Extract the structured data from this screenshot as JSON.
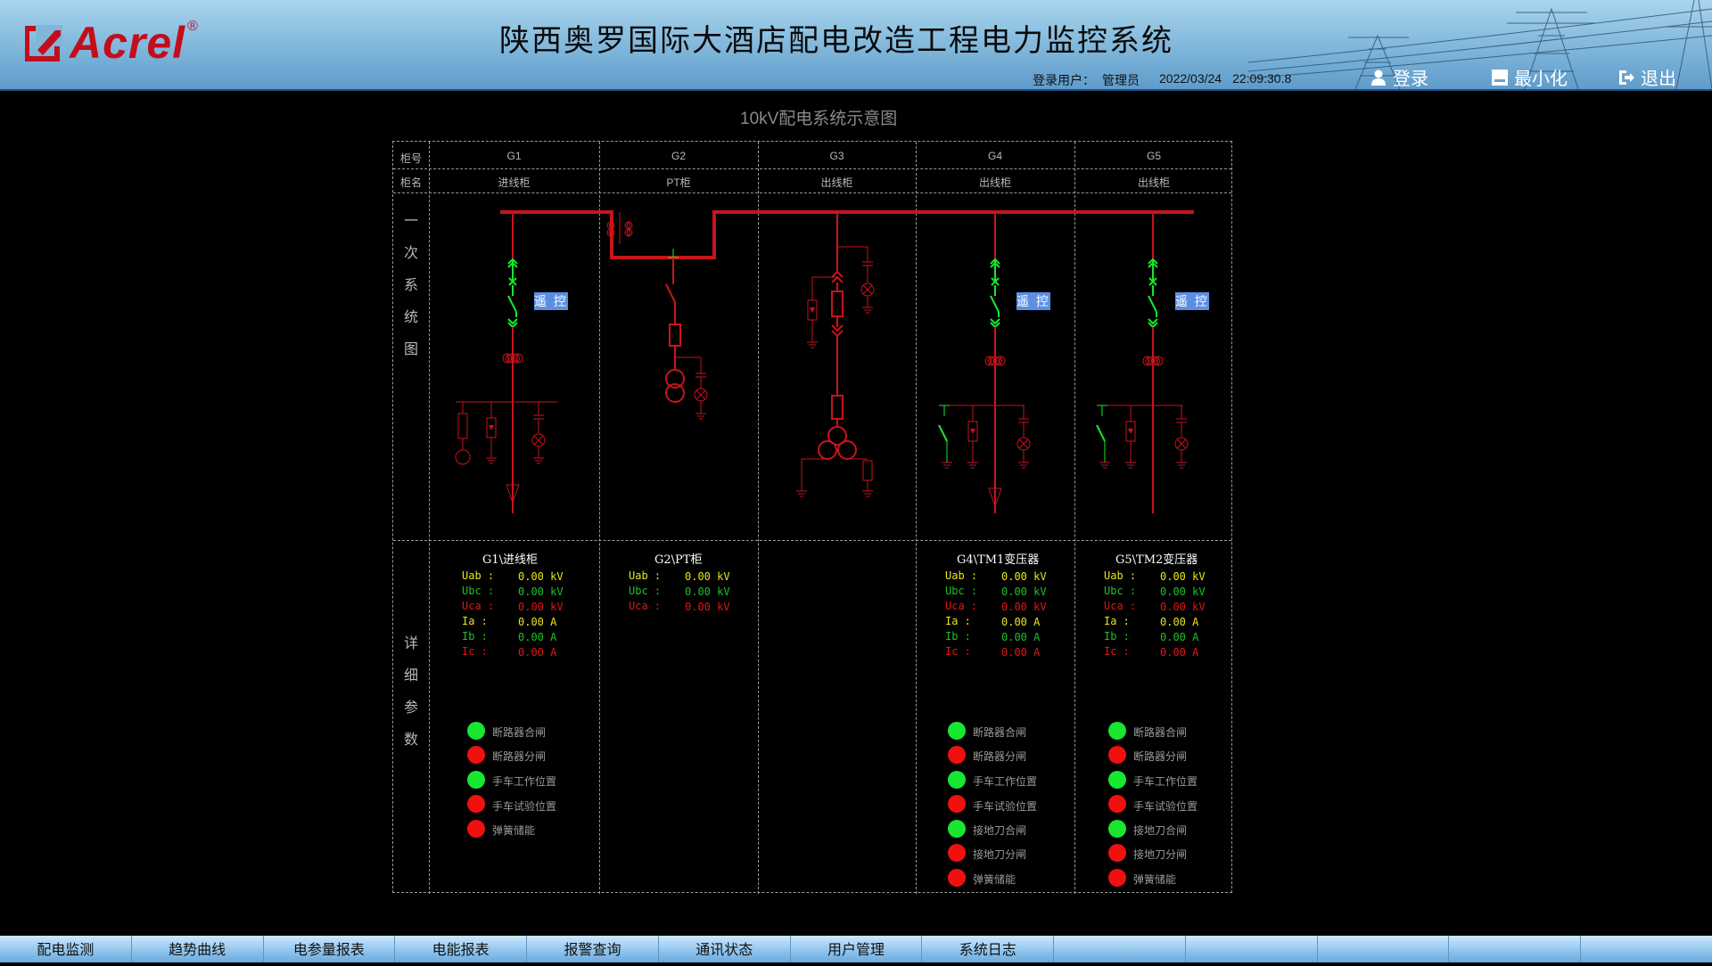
{
  "header": {
    "brand": "Acrel",
    "brand_mark": "®",
    "title": "陕西奥罗国际大酒店配电改造工程电力监控系统",
    "user_label": "登录用户：",
    "user_name": "管理员",
    "date": "2022/03/24",
    "time": "22:09:30.8",
    "login": "登录",
    "minimize": "最小化",
    "exit": "退出"
  },
  "diagram": {
    "title": "10kV配电系统示意图",
    "row_cabinet_no": "柜号",
    "row_cabinet_name": "柜名",
    "section_primary": [
      "一",
      "次",
      "系",
      "统",
      "图"
    ],
    "section_detail": [
      "详",
      "细",
      "参",
      "数"
    ],
    "remote_label": "遥 控"
  },
  "cabinets": [
    {
      "no": "G1",
      "name": "进线柜",
      "panel_title": "G1\\进线柜"
    },
    {
      "no": "G2",
      "name": "PT柜",
      "panel_title": "G2\\PT柜"
    },
    {
      "no": "G3",
      "name": "出线柜",
      "panel_title": ""
    },
    {
      "no": "G4",
      "name": "出线柜",
      "panel_title": "G4\\TM1变压器"
    },
    {
      "no": "G5",
      "name": "出线柜",
      "panel_title": "G5\\TM2变压器"
    }
  ],
  "params": {
    "uab": {
      "label": "Uab :",
      "value": "0.00 kV"
    },
    "ubc": {
      "label": "Ubc :",
      "value": "0.00 kV"
    },
    "uca": {
      "label": "Uca :",
      "value": "0.00 kV"
    },
    "ia": {
      "label": "Ia :",
      "value": "0.00 A"
    },
    "ib": {
      "label": "Ib :",
      "value": "0.00 A"
    },
    "ic": {
      "label": "Ic :",
      "value": "0.00 A"
    }
  },
  "status": {
    "cb_close": "断路器合闸",
    "cb_open": "断路器分闸",
    "truck_work": "手车工作位置",
    "truck_test": "手车试验位置",
    "spring": "弹簧储能",
    "earth_close": "接地刀合闸",
    "earth_open": "接地刀分闸"
  },
  "colors": {
    "busbar": "#c8141b",
    "breaker": "#16e82c",
    "led_green": "#19e630",
    "led_red": "#f01010",
    "uab": "#e6e61a",
    "ubc": "#1fbf2c",
    "uca": "#e01616"
  },
  "nav": [
    "配电监测",
    "趋势曲线",
    "电参量报表",
    "电能报表",
    "报警查询",
    "通讯状态",
    "用户管理",
    "系统日志",
    "",
    "",
    "",
    "",
    ""
  ]
}
